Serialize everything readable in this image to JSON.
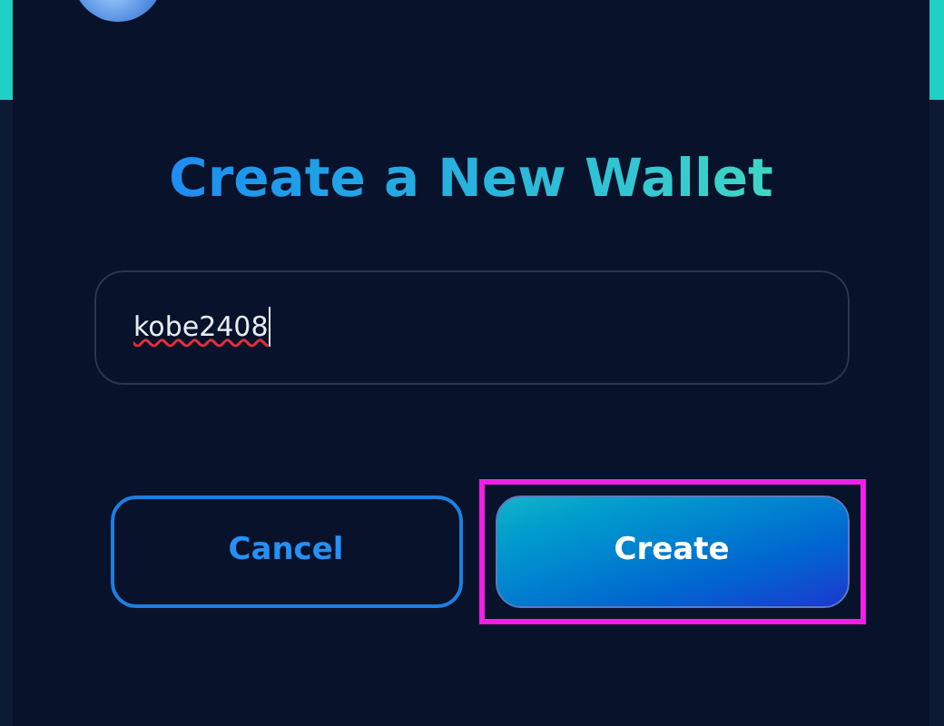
{
  "dialog": {
    "title": "Create a New Wallet",
    "name_field": {
      "value": "kobe2408",
      "spellcheck_error": true
    },
    "buttons": [
      {
        "label": "Cancel",
        "kind": "secondary",
        "highlighted": false
      },
      {
        "label": "Create",
        "kind": "primary",
        "highlighted": true
      }
    ]
  }
}
